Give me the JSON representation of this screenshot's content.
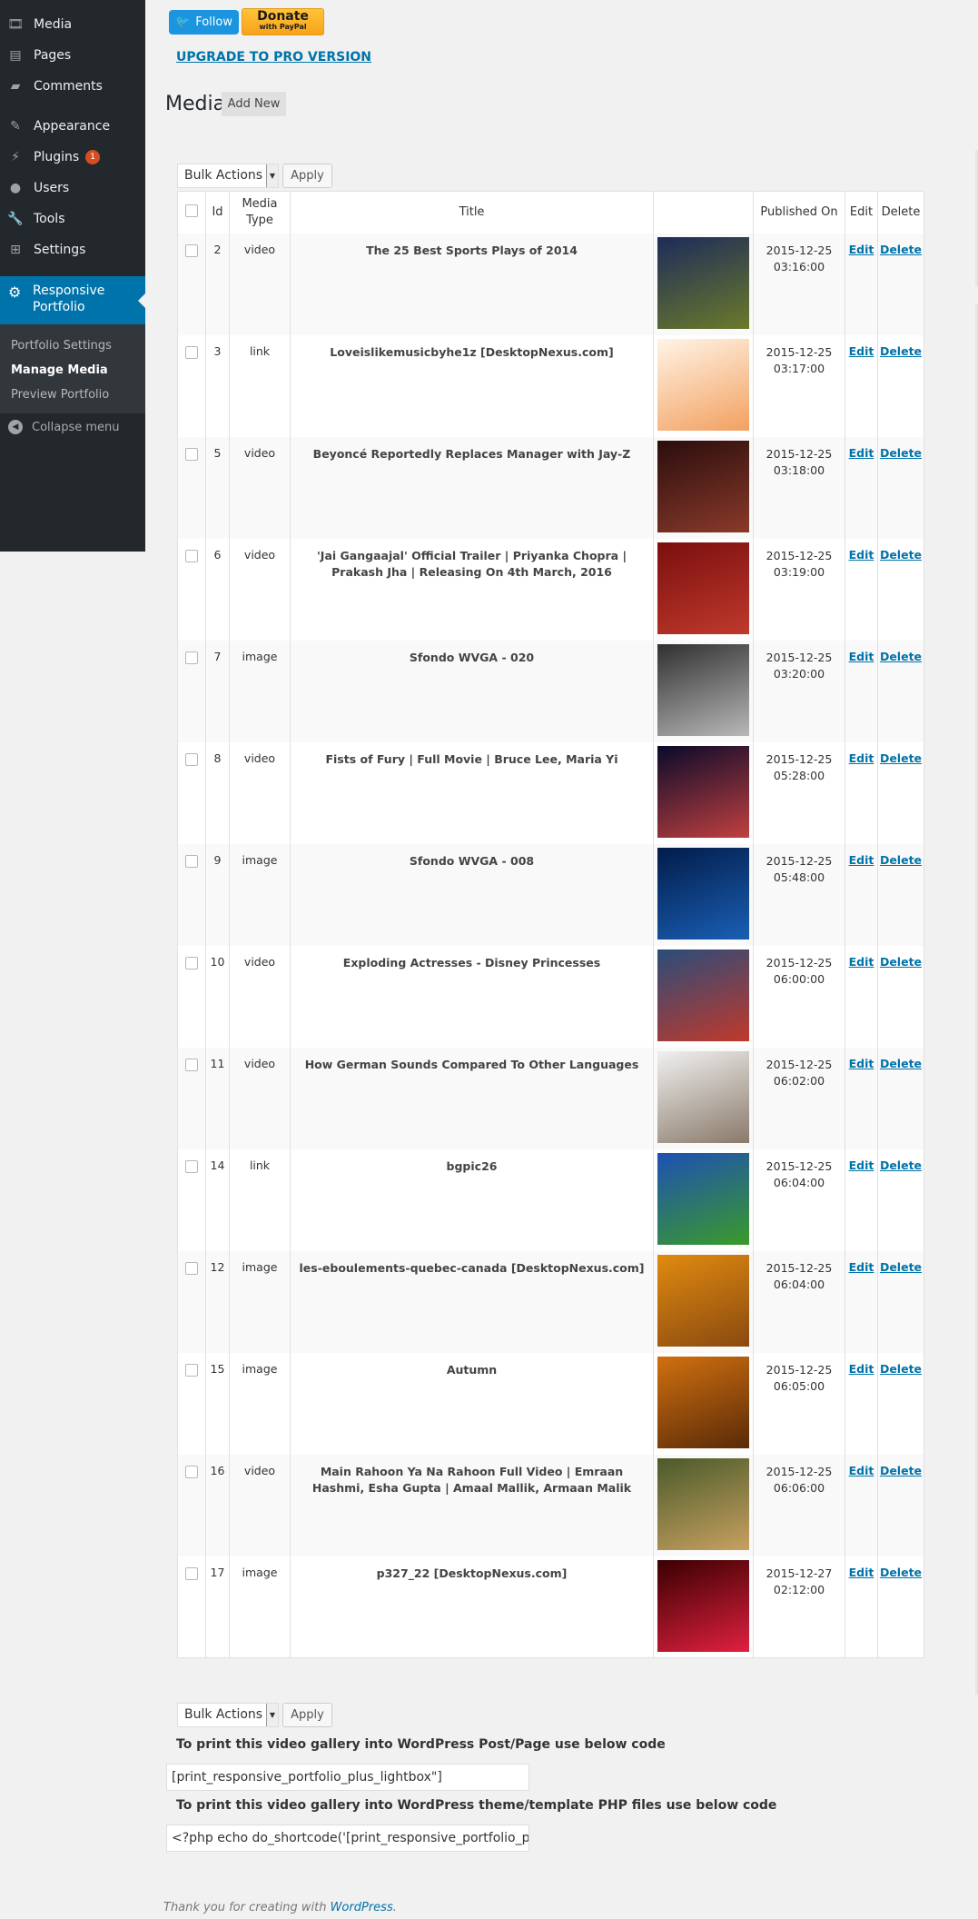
{
  "sidebar": {
    "items": [
      {
        "label": "Media",
        "icon": "media-icon"
      },
      {
        "label": "Pages",
        "icon": "pages-icon"
      },
      {
        "label": "Comments",
        "icon": "comments-icon"
      },
      {
        "label": "Appearance",
        "icon": "appearance-icon"
      },
      {
        "label": "Plugins",
        "icon": "plugins-icon",
        "badge": "1"
      },
      {
        "label": "Users",
        "icon": "users-icon"
      },
      {
        "label": "Tools",
        "icon": "tools-icon"
      },
      {
        "label": "Settings",
        "icon": "settings-icon"
      }
    ],
    "active": {
      "label": "Responsive Portfolio",
      "icon": "gear-icon"
    },
    "submenu": [
      "Portfolio Settings",
      "Manage Media",
      "Preview Portfolio"
    ],
    "current_submenu": "Manage Media",
    "collapse": "Collapse menu"
  },
  "top": {
    "follow": "Follow",
    "donate": "Donate",
    "donate_sub": "with PayPal",
    "upgrade": "UPGRADE TO PRO VERSION"
  },
  "header": {
    "title": "Media",
    "add_new": "Add New"
  },
  "bulk": {
    "select": "Bulk Actions",
    "apply": "Apply"
  },
  "table": {
    "columns": [
      "Id",
      "Media Type",
      "Title",
      "",
      "Published On",
      "Edit",
      "Delete"
    ],
    "edit_label": "Edit",
    "delete_label": "Delete",
    "rows": [
      {
        "id": "2",
        "type": "video",
        "title": "The 25 Best Sports Plays of 2014",
        "date": "2015-12-25",
        "time": "03:16:00",
        "thumb": [
          "#1d2b5a",
          "#6b7a2a"
        ]
      },
      {
        "id": "3",
        "type": "link",
        "title": "Loveislikemusicbyhe1z [DesktopNexus.com]",
        "date": "2015-12-25",
        "time": "03:17:00",
        "thumb": [
          "#fff4e6",
          "#f2a060"
        ]
      },
      {
        "id": "5",
        "type": "video",
        "title": "Beyoncé Reportedly Replaces Manager with Jay-Z",
        "date": "2015-12-25",
        "time": "03:18:00",
        "thumb": [
          "#2a0d0d",
          "#8a3a2a"
        ]
      },
      {
        "id": "6",
        "type": "video",
        "title": "'Jai Gangaajal' Official Trailer | Priyanka Chopra | Prakash Jha | Releasing On 4th March, 2016",
        "date": "2015-12-25",
        "time": "03:19:00",
        "thumb": [
          "#7a0f0f",
          "#c0392b"
        ]
      },
      {
        "id": "7",
        "type": "image",
        "title": "Sfondo WVGA - 020",
        "date": "2015-12-25",
        "time": "03:20:00",
        "thumb": [
          "#303030",
          "#b8b8b8"
        ]
      },
      {
        "id": "8",
        "type": "video",
        "title": "Fists of Fury | Full Movie | Bruce Lee, Maria Yi",
        "date": "2015-12-25",
        "time": "05:28:00",
        "thumb": [
          "#0a0a2a",
          "#c04040"
        ]
      },
      {
        "id": "9",
        "type": "image",
        "title": "Sfondo WVGA - 008",
        "date": "2015-12-25",
        "time": "05:48:00",
        "thumb": [
          "#021c4a",
          "#1a5fb4"
        ]
      },
      {
        "id": "10",
        "type": "video",
        "title": "Exploding Actresses - Disney Princesses",
        "date": "2015-12-25",
        "time": "06:00:00",
        "thumb": [
          "#2a4c7a",
          "#c0392b"
        ]
      },
      {
        "id": "11",
        "type": "video",
        "title": "How German Sounds Compared To Other Languages",
        "date": "2015-12-25",
        "time": "06:02:00",
        "thumb": [
          "#f0f0f0",
          "#8a7a6a"
        ]
      },
      {
        "id": "14",
        "type": "link",
        "title": "bgpic26",
        "date": "2015-12-25",
        "time": "06:04:00",
        "thumb": [
          "#1e50b4",
          "#3a9a2a"
        ]
      },
      {
        "id": "12",
        "type": "image",
        "title": "les-eboulements-quebec-canada [DesktopNexus.com]",
        "date": "2015-12-25",
        "time": "06:04:00",
        "thumb": [
          "#e08a10",
          "#8a4a10"
        ]
      },
      {
        "id": "15",
        "type": "image",
        "title": "Autumn",
        "date": "2015-12-25",
        "time": "06:05:00",
        "thumb": [
          "#d07010",
          "#5a2a08"
        ]
      },
      {
        "id": "16",
        "type": "video",
        "title": "Main Rahoon Ya Na Rahoon Full Video | Emraan Hashmi, Esha Gupta | Amaal Mallik, Armaan Malik",
        "date": "2015-12-25",
        "time": "06:06:00",
        "thumb": [
          "#4a5a2a",
          "#c8a060"
        ]
      },
      {
        "id": "17",
        "type": "image",
        "title": "p327_22 [DesktopNexus.com]",
        "date": "2015-12-27",
        "time": "02:12:00",
        "thumb": [
          "#3a0000",
          "#e02040"
        ]
      }
    ]
  },
  "shortcodes": {
    "post_note": "To print this video gallery into WordPress Post/Page use below code",
    "post_code": "[print_responsive_portfolio_plus_lightbox\"]",
    "php_note": "To print this video gallery into WordPress theme/template PHP files use below code",
    "php_code": "<?php echo do_shortcode('[print_responsive_portfolio_plus_lightbox\"]'); ?>"
  },
  "footer": {
    "text": "Thank you for creating with ",
    "link": "WordPress",
    "end": "."
  },
  "colors": {
    "sidebar": "#23282d",
    "accent": "#0073aa",
    "badge": "#d54e21"
  }
}
